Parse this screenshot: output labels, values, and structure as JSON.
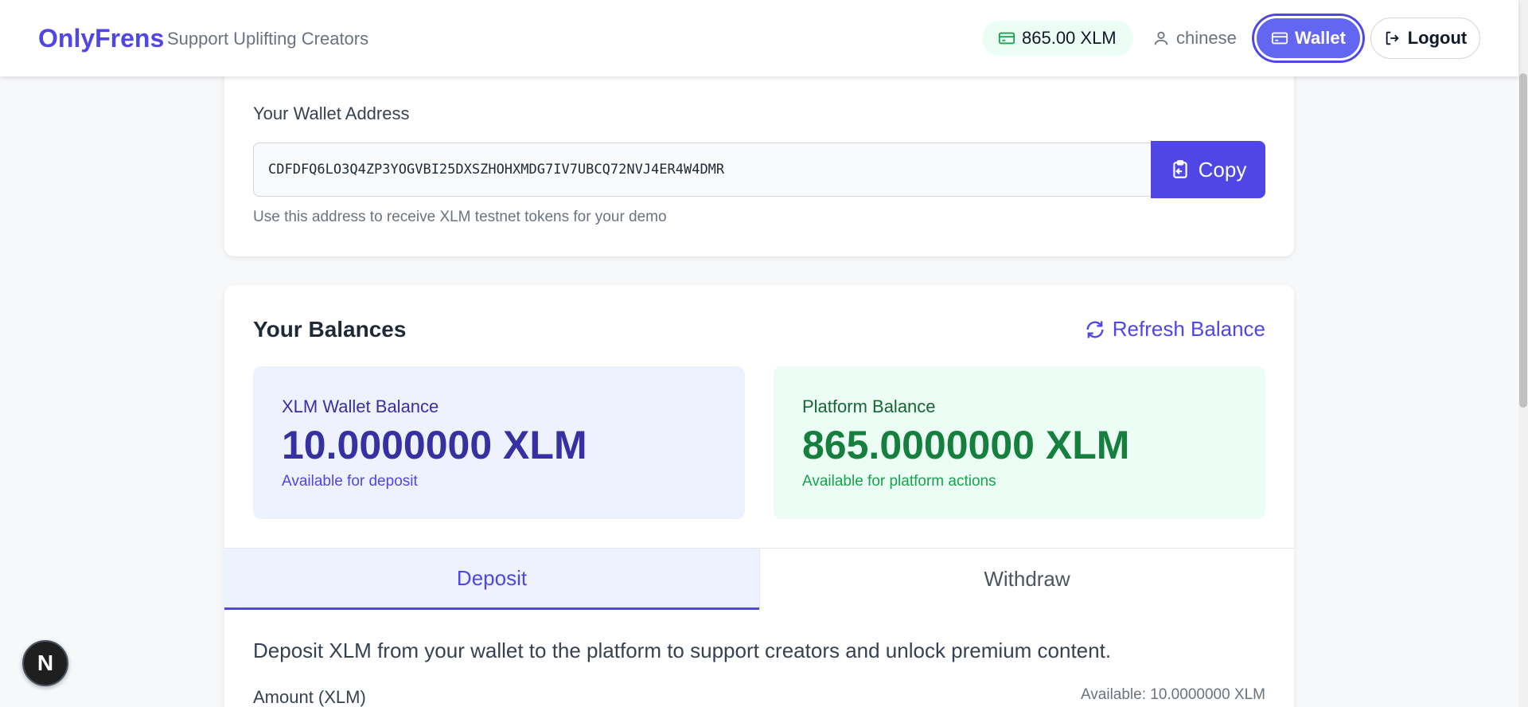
{
  "header": {
    "brand": "OnlyFrens",
    "tagline": "Support Uplifting Creators",
    "balance": "865.00 XLM",
    "username": "chinese",
    "wallet_label": "Wallet",
    "logout_label": "Logout"
  },
  "address_card": {
    "label": "Your Wallet Address",
    "address": "CDFDFQ6LO3Q4ZP3YOGVBI25DXSZHOHXMDG7IV7UBCQ72NVJ4ER4W4DMR",
    "copy_label": "Copy",
    "help": "Use this address to receive XLM testnet tokens for your demo"
  },
  "balances": {
    "title": "Your Balances",
    "refresh_label": "Refresh Balance",
    "xlm": {
      "label": "XLM Wallet Balance",
      "amount": "10.0000000 XLM",
      "sub": "Available for deposit"
    },
    "platform": {
      "label": "Platform Balance",
      "amount": "865.0000000 XLM",
      "sub": "Available for platform actions"
    }
  },
  "tabs": {
    "deposit": "Deposit",
    "withdraw": "Withdraw"
  },
  "deposit": {
    "description": "Deposit XLM from your wallet to the platform to support creators and unlock premium content.",
    "amount_label": "Amount (XLM)",
    "available": "Available: 10.0000000 XLM"
  },
  "badge": "N",
  "colors": {
    "accent": "#4f46e5",
    "success": "#15803d"
  }
}
